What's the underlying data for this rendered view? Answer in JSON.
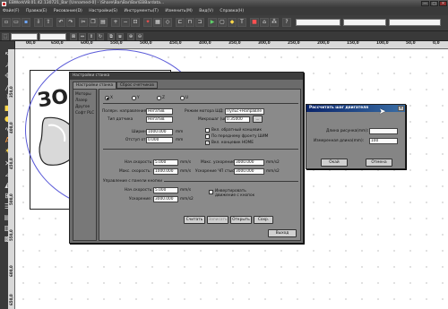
{
  "window": {
    "title": "EBWorkV8.01.42.130721_Bar [Unnamed-0] - \\Share\\Bar\\Bar\\Bar\\EBBardata...",
    "min_glyph": "—",
    "max_glyph": "□",
    "close_glyph": "✕"
  },
  "menu": {
    "items": [
      "Файл(F)",
      "Правка(E)",
      "Рисование(D)",
      "Настройки(S)",
      "Инструменты(T)",
      "Изменить(M)",
      "Вид(V)",
      "Справка(H)"
    ]
  },
  "toolbar": {
    "dropdowns": [
      "",
      "",
      ""
    ],
    "row2_dropdowns": [
      "",
      ""
    ]
  },
  "ruler": {
    "h_ticks": [
      "00,0",
      "650,0",
      "600,0",
      "550,0",
      "500,0",
      "450,0",
      "400,0",
      "350,0",
      "300,0",
      "250,0",
      "200,0",
      "150,0",
      "100,0",
      "50,0",
      "0,0"
    ],
    "v_ticks": [
      "350,0",
      "400,0",
      "450,0",
      "500,0",
      "550,0",
      "600,0",
      "650,0"
    ]
  },
  "canvas": {
    "shape_text": "ЗО"
  },
  "settings_dialog": {
    "title": "Настройки станка",
    "tabs": [
      "Настройки станка",
      "Сброс счетчиков"
    ],
    "sidebar": [
      "Моторы",
      "Лазер",
      "Другое",
      "Софт PLC"
    ],
    "axes": [
      "X",
      "Y",
      "Z",
      "U"
    ],
    "direction_label": "Полярн. направления",
    "direction_value": "Негатив",
    "sensor_label": "Тип датчика",
    "sensor_value": "Негатив",
    "motor_mode_label": "Режим мотора ШД:",
    "motor_mode_value": "Пульс+Направле",
    "microstep_label": "Микрошаг (um):",
    "microstep_value": "0.35000",
    "microstep_btn": "...",
    "width_label": "Ширина:",
    "width_value": "1000.000",
    "width_unit": "mm",
    "offset_label": "Отступ от 0:",
    "offset_value": "0.000",
    "offset_unit": "mm",
    "check_reverse": "Вкл. обратный концевик",
    "check_pwm": "По переднему фронту ШИМ",
    "check_home": "Вкл. концевик HOME",
    "start_speed_label": "Нач.скорость:",
    "start_speed_value": "5.000",
    "start_speed_unit": "mm/s",
    "max_speed_label": "Макс. скорость:",
    "max_speed_value": "1000.000",
    "max_speed_unit": "mm/s",
    "max_accel_label": "Макс. ускорение:",
    "max_accel_value": "3000.000",
    "max_accel_unit": "mm/s2",
    "quick_accel_label": "Ускорение ЧП стыс:",
    "quick_accel_value": "3000.000",
    "quick_accel_unit": "mm/s2",
    "panel_group": "Управление с панели кнопки",
    "panel_speed_label": "Нач.скорость:",
    "panel_speed_value": "5.000",
    "panel_speed_unit": "mm/s",
    "panel_accel_label": "Ускорение:",
    "panel_accel_value": "3000.000",
    "panel_accel_unit": "mm/s2",
    "check_invert": "Инвертировать движение с кнопок",
    "btn_read": "Считать",
    "btn_write": "Записать",
    "btn_open": "Открыть",
    "btn_save": "Сохр.",
    "btn_exit": "Выход"
  },
  "step_dialog": {
    "title": "Рассчитать шаг двигателя",
    "length_label": "Длина рисунка(mm):",
    "length_value": "",
    "measured_label": "Измеренная длина(mm):",
    "measured_value": "100",
    "ok": "Окай",
    "cancel": "Отмена",
    "close_glyph": "✕"
  }
}
